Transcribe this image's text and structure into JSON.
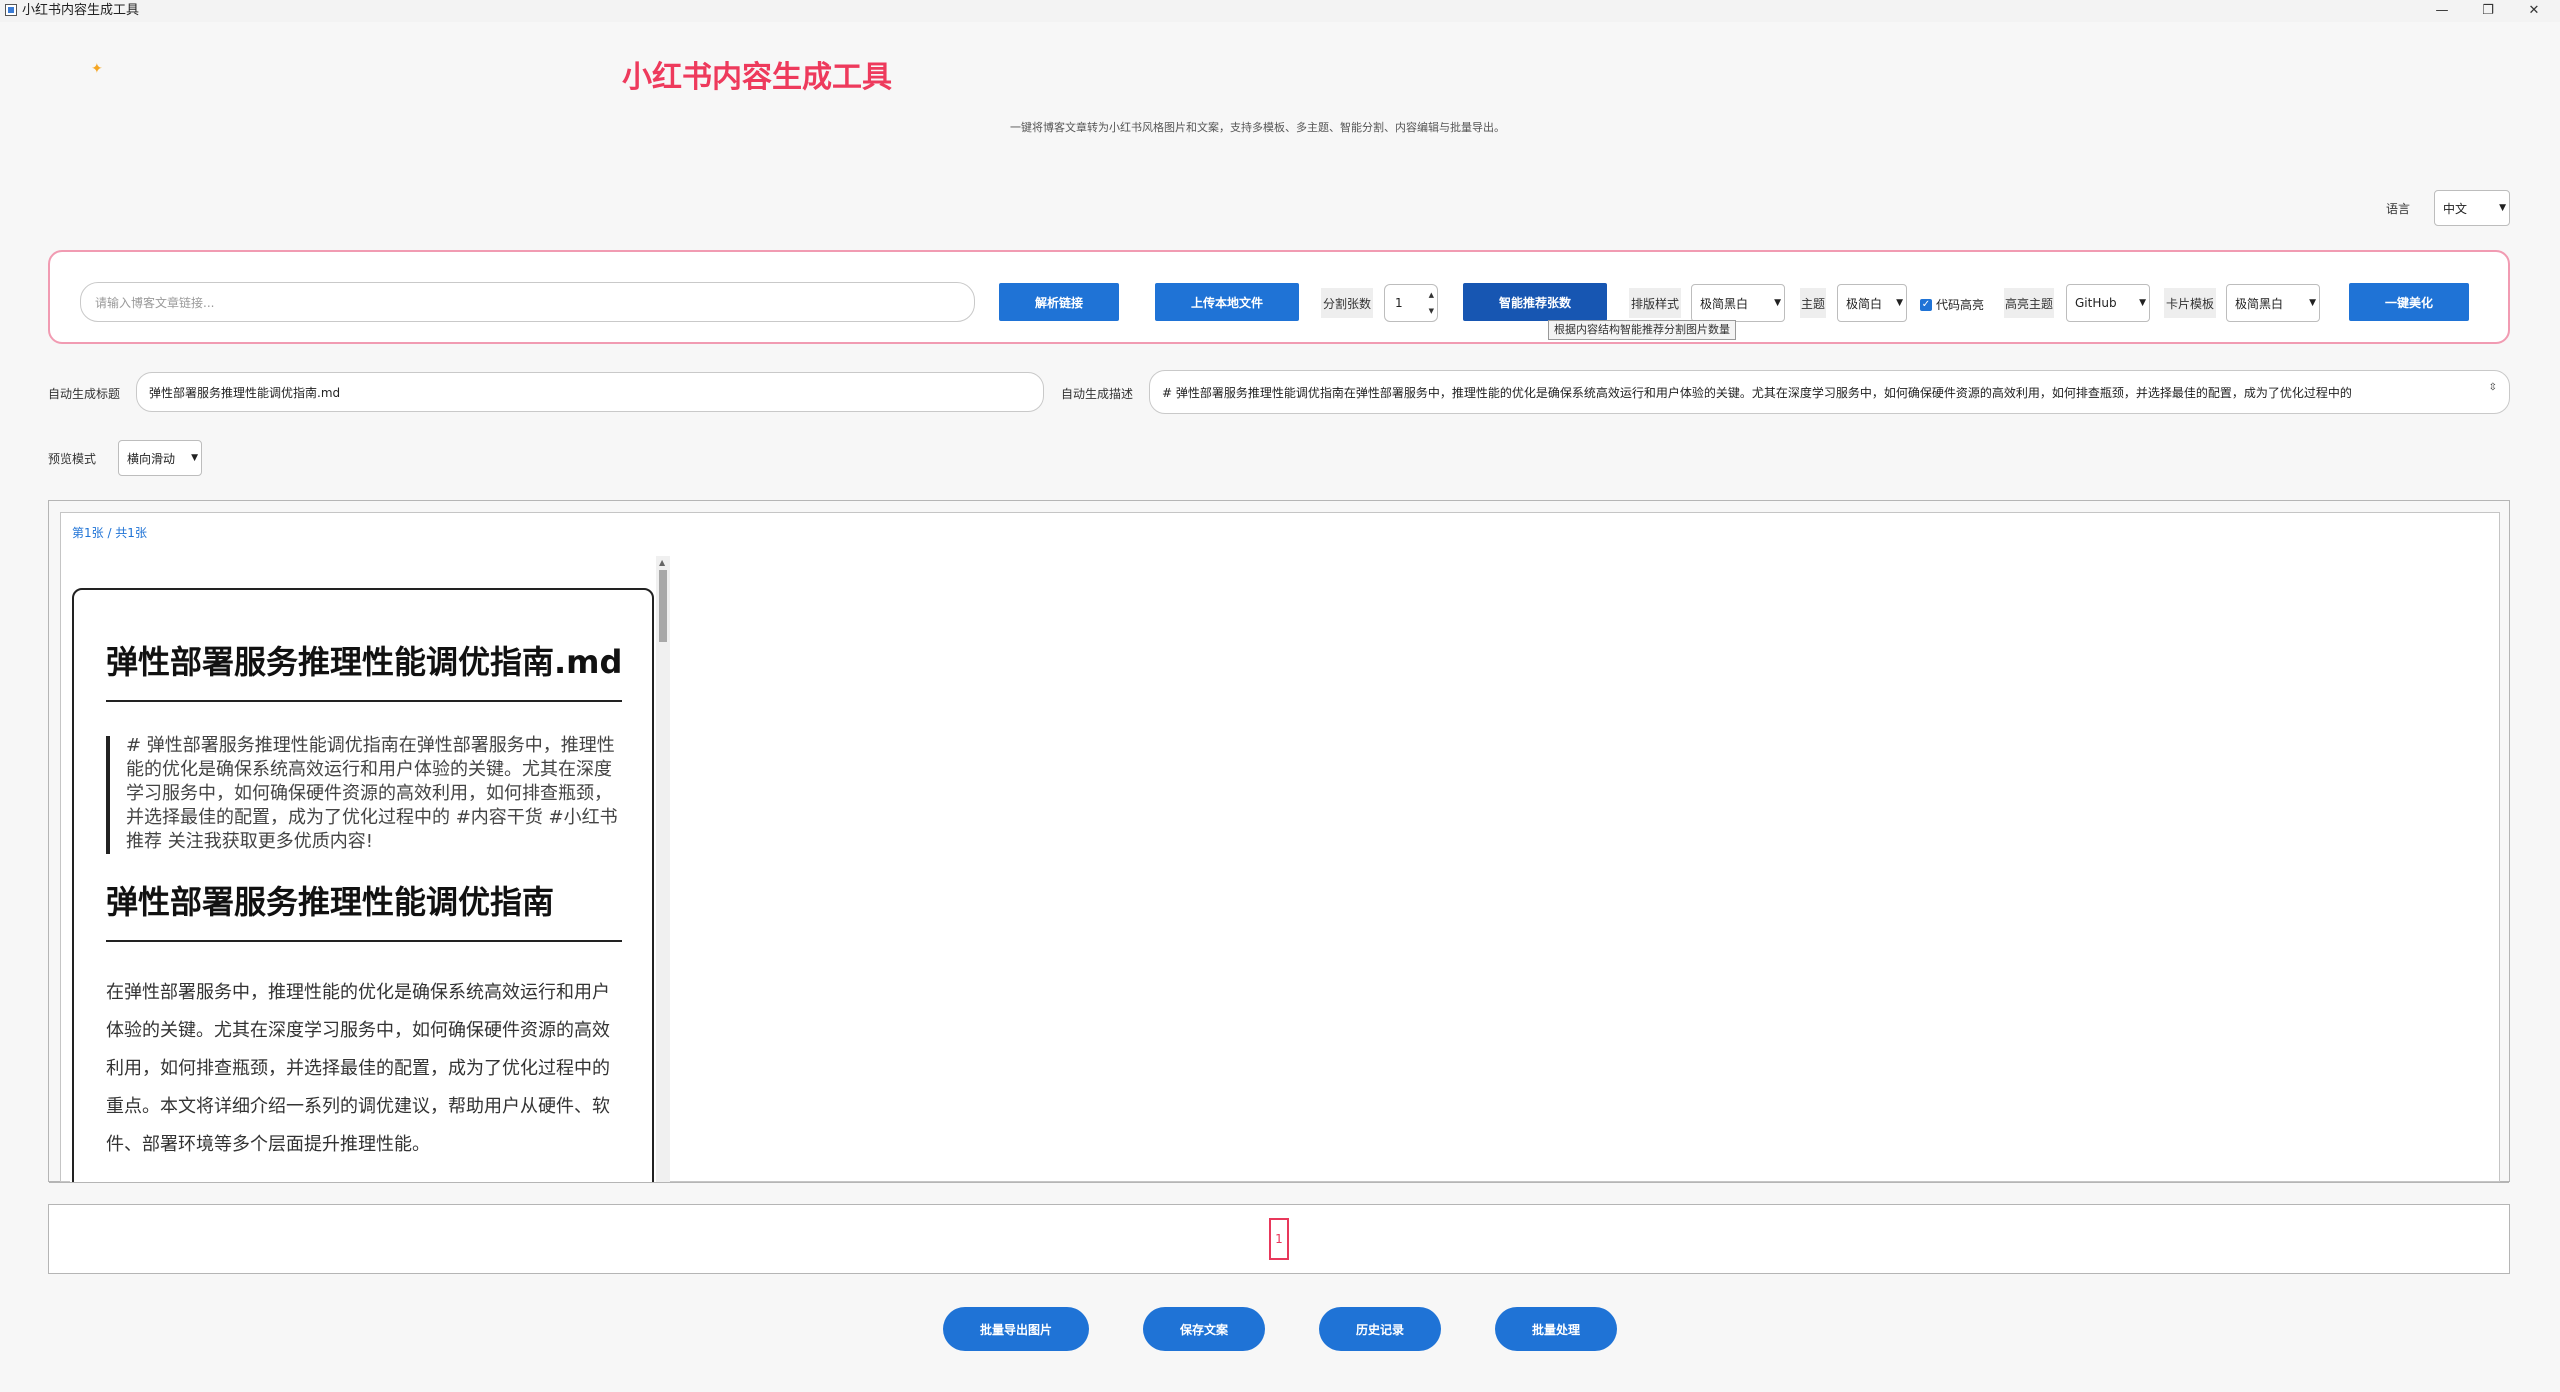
{
  "window": {
    "title": "小红书内容生成工具",
    "minimize_icon": "minimize-icon",
    "maximize_icon": "maximize-icon",
    "close_icon": "close-icon"
  },
  "header": {
    "title": "小红书内容生成工具",
    "subtitle": "一键将博客文章转为小红书风格图片和文案，支持多模板、多主题、智能分割、内容编辑与批量导出。"
  },
  "language": {
    "label": "语言",
    "value": "中文"
  },
  "toolbar": {
    "url_placeholder": "请输入博客文章链接...",
    "parse_button": "解析链接",
    "upload_button": "上传本地文件",
    "split_label": "分割张数",
    "split_value": "1",
    "smart_button": "智能推荐张数",
    "smart_tooltip": "根据内容结构智能推荐分割图片数量",
    "layout_label": "排版样式",
    "layout_value": "极简黑白",
    "theme_label": "主题",
    "theme_value": "极简白",
    "code_highlight_label": "代码高亮",
    "code_highlight_checked": true,
    "highlight_theme_label": "高亮主题",
    "highlight_theme_value": "GitHub",
    "card_template_label": "卡片模板",
    "card_template_value": "极简黑白",
    "beautify_button": "一键美化"
  },
  "auto": {
    "title_label": "自动生成标题",
    "title_value": "弹性部署服务推理性能调优指南.md",
    "desc_label": "自动生成描述",
    "desc_value": "# 弹性部署服务推理性能调优指南在弹性部署服务中，推理性能的优化是确保系统高效运行和用户体验的关键。尤其在深度学习服务中，如何确保硬件资源的高效利用，如何排查瓶颈，并选择最佳的配置，成为了优化过程中的"
  },
  "preview": {
    "mode_label": "预览模式",
    "mode_value": "横向滑动",
    "page_indicator": "第1张 / 共1张",
    "card": {
      "h1": "弹性部署服务推理性能调优指南.md",
      "quote": "# 弹性部署服务推理性能调优指南在弹性部署服务中，推理性能的优化是确保系统高效运行和用户体验的关键。尤其在深度学习服务中，如何确保硬件资源的高效利用，如何排查瓶颈，并选择最佳的配置，成为了优化过程中的 #内容干货 #小红书推荐 关注我获取更多优质内容!",
      "h2": "弹性部署服务推理性能调优指南",
      "paragraph": "在弹性部署服务中，推理性能的优化是确保系统高效运行和用户体验的关键。尤其在深度学习服务中，如何确保硬件资源的高效利用，如何排查瓶颈，并选择最佳的配置，成为了优化过程中的重点。本文将详细介绍一系列的调优建议，帮助用户从硬件、软件、部署环境等多个层面提升推理性能。"
    }
  },
  "pagination": {
    "current": "1"
  },
  "bottom": {
    "export_button": "批量导出图片",
    "save_button": "保存文案",
    "history_button": "历史记录",
    "batch_button": "批量处理"
  },
  "colors": {
    "accent": "#1f73d6",
    "brand": "#ee3a5c",
    "panel_border": "#f19bb2"
  }
}
